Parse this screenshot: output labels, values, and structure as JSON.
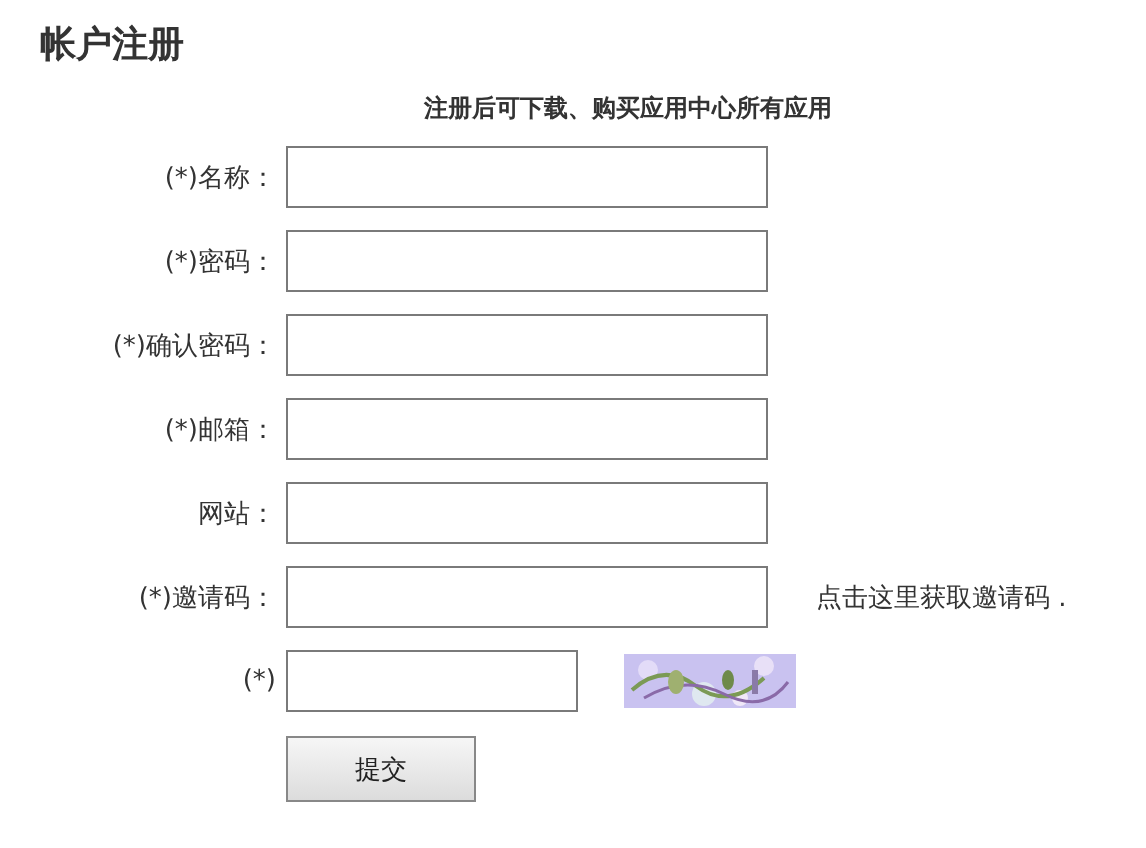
{
  "title": "帐户注册",
  "notice": "注册后可下载、购买应用中心所有应用",
  "fields": [
    {
      "kind": "text",
      "label": "(*)名称："
    },
    {
      "kind": "text",
      "label": "(*)密码："
    },
    {
      "kind": "text",
      "label": "(*)确认密码："
    },
    {
      "kind": "text",
      "label": "(*)邮箱："
    },
    {
      "kind": "text",
      "label": "网站："
    },
    {
      "kind": "invite",
      "label": "(*)邀请码：",
      "link": "点击这里获取邀请码 ."
    },
    {
      "kind": "captcha",
      "label": "(*)"
    }
  ],
  "submit": "提交"
}
